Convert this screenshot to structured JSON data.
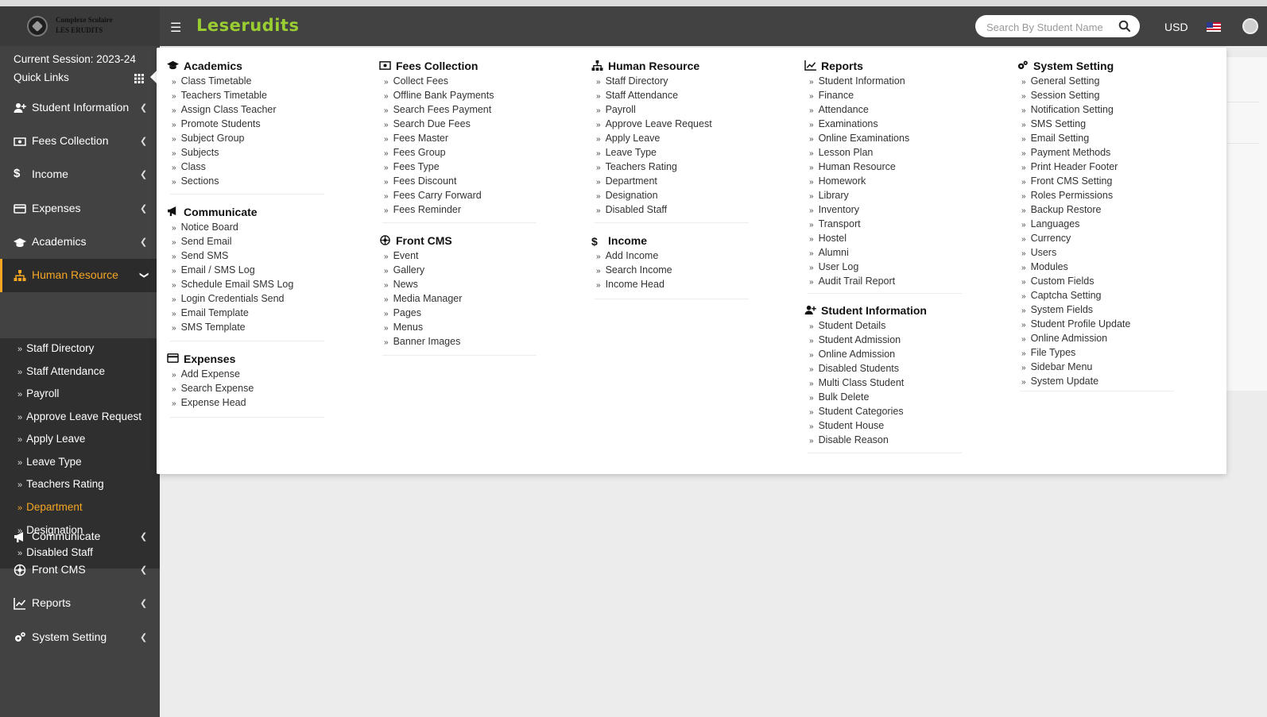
{
  "header": {
    "logo_line1": "Complexe Scolaire",
    "logo_line2": "LES ERUDITS",
    "app_name": "Leserudits",
    "search_placeholder": "Search By Student Name",
    "currency": "USD"
  },
  "sidebar": {
    "session": "Current Session: 2023-24",
    "quick_links": "Quick Links",
    "items": [
      {
        "label": "Student Information",
        "icon": "user-plus-icon"
      },
      {
        "label": "Fees Collection",
        "icon": "money-icon"
      },
      {
        "label": "Income",
        "icon": "dollar-icon"
      },
      {
        "label": "Expenses",
        "icon": "credit-card-icon"
      },
      {
        "label": "Academics",
        "icon": "graduation-cap-icon"
      },
      {
        "label": "Human Resource",
        "icon": "sitemap-icon"
      },
      {
        "label": "Communicate",
        "icon": "bullhorn-icon"
      },
      {
        "label": "Front CMS",
        "icon": "empire-icon"
      },
      {
        "label": "Reports",
        "icon": "line-chart-icon"
      },
      {
        "label": "System Setting",
        "icon": "gears-icon"
      }
    ],
    "hr_submenu": [
      "Staff Directory",
      "Staff Attendance",
      "Payroll",
      "Approve Leave Request",
      "Apply Leave",
      "Leave Type",
      "Teachers Rating",
      "Department",
      "Designation",
      "Disabled Staff"
    ]
  },
  "mega": {
    "academics": {
      "title": "Academics",
      "links": [
        "Class Timetable",
        "Teachers Timetable",
        "Assign Class Teacher",
        "Promote Students",
        "Subject Group",
        "Subjects",
        "Class",
        "Sections"
      ]
    },
    "communicate": {
      "title": "Communicate",
      "links": [
        "Notice Board",
        "Send Email",
        "Send SMS",
        "Email / SMS Log",
        "Schedule Email SMS Log",
        "Login Credentials Send",
        "Email Template",
        "SMS Template"
      ]
    },
    "expenses": {
      "title": "Expenses",
      "links": [
        "Add Expense",
        "Search Expense",
        "Expense Head"
      ]
    },
    "fees": {
      "title": "Fees Collection",
      "links": [
        "Collect Fees",
        "Offline Bank Payments",
        "Search Fees Payment",
        "Search Due Fees",
        "Fees Master",
        "Fees Group",
        "Fees Type",
        "Fees Discount",
        "Fees Carry Forward",
        "Fees Reminder"
      ]
    },
    "frontcms": {
      "title": "Front CMS",
      "links": [
        "Event",
        "Gallery",
        "News",
        "Media Manager",
        "Pages",
        "Menus",
        "Banner Images"
      ]
    },
    "hr": {
      "title": "Human Resource",
      "links": [
        "Staff Directory",
        "Staff Attendance",
        "Payroll",
        "Approve Leave Request",
        "Apply Leave",
        "Leave Type",
        "Teachers Rating",
        "Department",
        "Designation",
        "Disabled Staff"
      ]
    },
    "income": {
      "title": "Income",
      "links": [
        "Add Income",
        "Search Income",
        "Income Head"
      ]
    },
    "reports": {
      "title": "Reports",
      "links": [
        "Student Information",
        "Finance",
        "Attendance",
        "Examinations",
        "Online Examinations",
        "Lesson Plan",
        "Human Resource",
        "Homework",
        "Library",
        "Inventory",
        "Transport",
        "Hostel",
        "Alumni",
        "User Log",
        "Audit Trail Report"
      ]
    },
    "student": {
      "title": "Student Information",
      "links": [
        "Student Details",
        "Student Admission",
        "Online Admission",
        "Disabled Students",
        "Multi Class Student",
        "Bulk Delete",
        "Student Categories",
        "Student House",
        "Disable Reason"
      ]
    },
    "system": {
      "title": "System Setting",
      "links": [
        "General Setting",
        "Session Setting",
        "Notification Setting",
        "SMS Setting",
        "Email Setting",
        "Payment Methods",
        "Print Header Footer",
        "Front CMS Setting",
        "Roles Permissions",
        "Backup Restore",
        "Languages",
        "Currency",
        "Users",
        "Modules",
        "Custom Fields",
        "Captcha Setting",
        "System Fields",
        "Student Profile Update",
        "Online Admission",
        "File Types",
        "Sidebar Menu",
        "System Update"
      ]
    }
  }
}
